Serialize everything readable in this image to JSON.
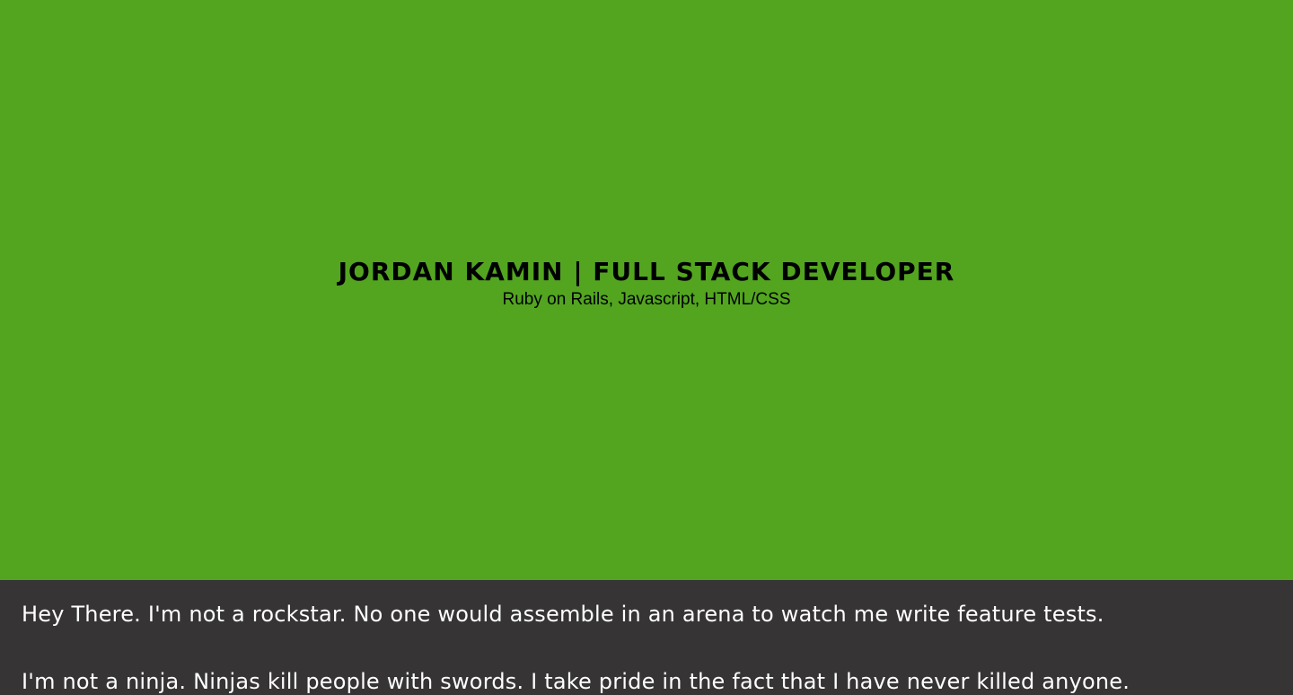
{
  "hero": {
    "title": "Jordan Kamin | Full Stack Developer",
    "subtitle": "Ruby on Rails, Javascript, HTML/CSS",
    "background_color": "#53a520"
  },
  "about": {
    "background_color": "#363435",
    "paragraphs": [
      "Hey There. I'm not a rockstar. No one would assemble in an arena to watch me write feature tests.",
      "I'm not a ninja. Ninjas kill people with swords. I take pride in the fact that I have never killed anyone."
    ]
  }
}
